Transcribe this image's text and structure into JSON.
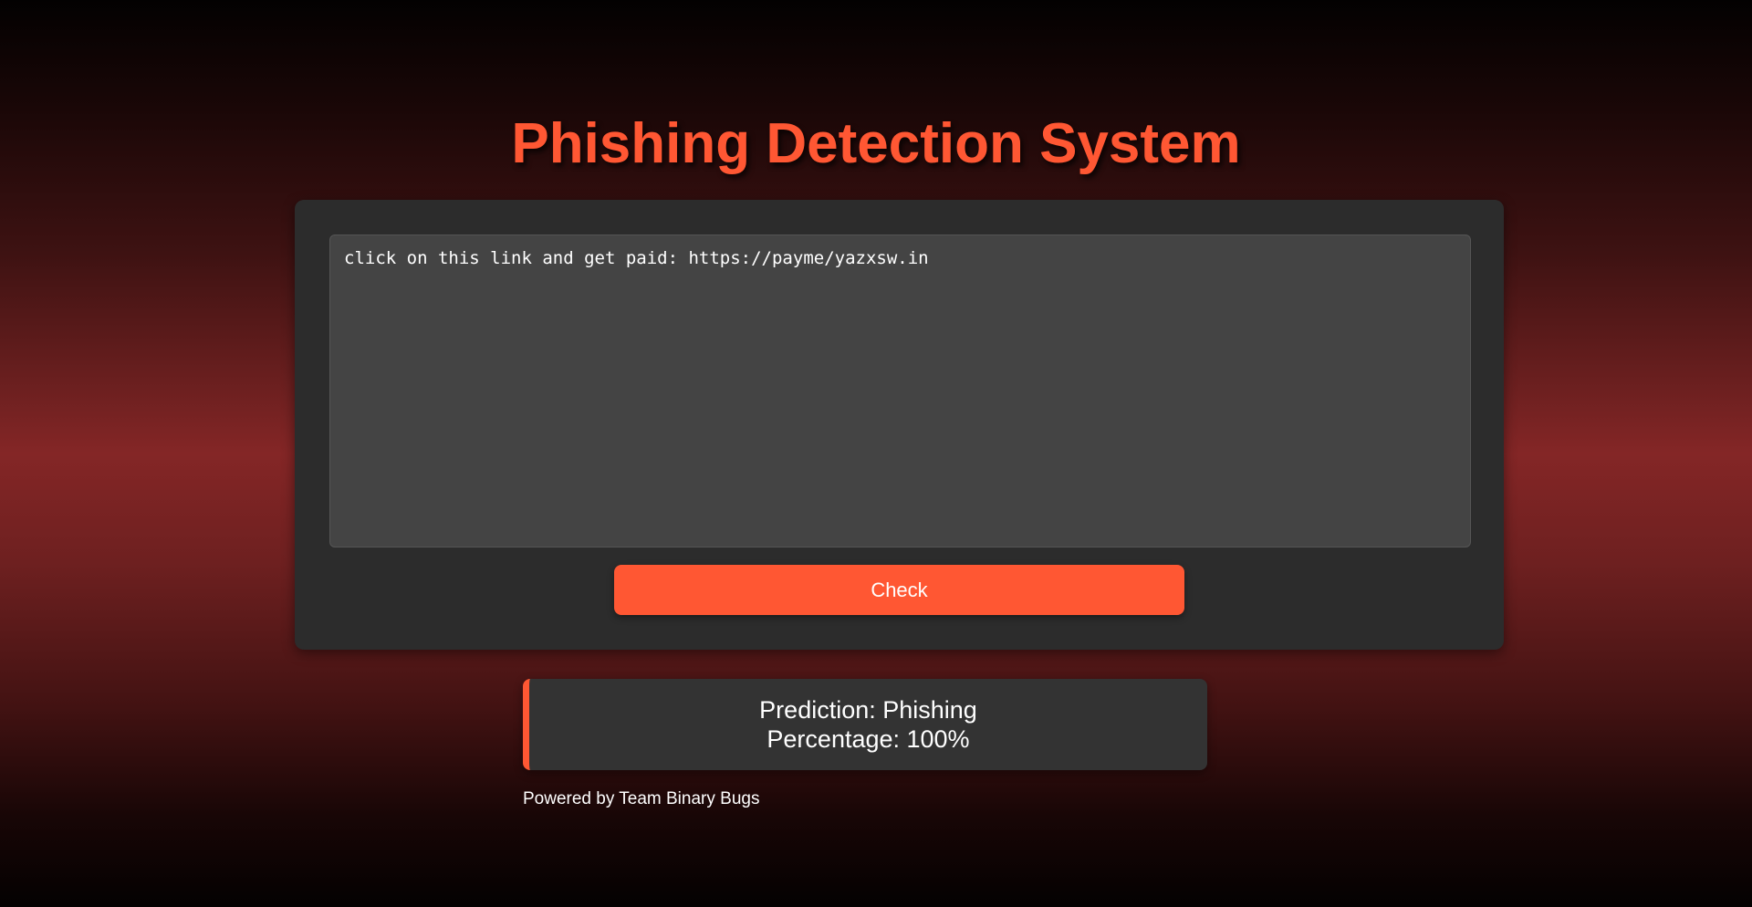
{
  "header": {
    "title": "Phishing Detection System"
  },
  "form": {
    "message_value": "click on this link and get paid: https://payme/yazxsw.in",
    "check_label": "Check"
  },
  "result": {
    "prediction": "Prediction: Phishing",
    "percentage": "Percentage: 100%"
  },
  "footer": {
    "credit": "Powered by Team Binary Bugs"
  },
  "colors": {
    "accent": "#ff5733",
    "card_background": "#2c2c2c",
    "input_background": "#444444",
    "result_background": "#333333",
    "text": "#ffffff"
  }
}
